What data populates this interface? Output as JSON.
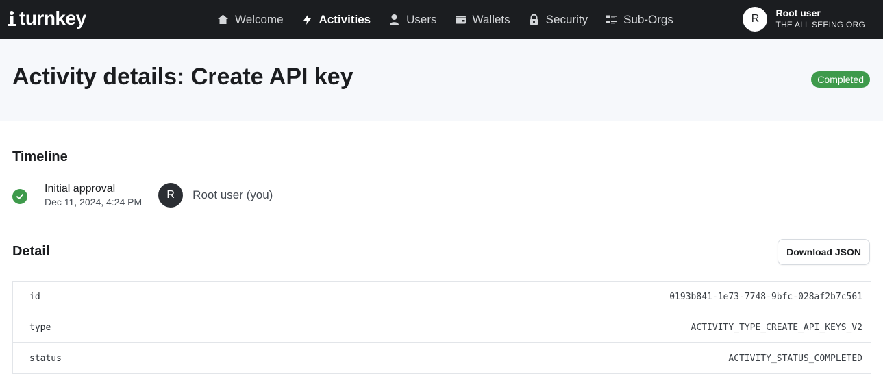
{
  "brand": {
    "name": "turnkey"
  },
  "nav": {
    "items": [
      {
        "label": "Welcome",
        "icon": "home-icon"
      },
      {
        "label": "Activities",
        "icon": "bolt-icon",
        "active": true
      },
      {
        "label": "Users",
        "icon": "user-icon"
      },
      {
        "label": "Wallets",
        "icon": "wallet-icon"
      },
      {
        "label": "Security",
        "icon": "lock-icon"
      },
      {
        "label": "Sub-Orgs",
        "icon": "list-icon"
      }
    ]
  },
  "user": {
    "initial": "R",
    "name": "Root user",
    "org": "THE ALL SEEING ORG"
  },
  "page": {
    "title": "Activity details: Create API key",
    "status": "Completed"
  },
  "timeline": {
    "title": "Timeline",
    "entry": {
      "label": "Initial approval",
      "date": "Dec 11, 2024, 4:24 PM",
      "user_initial": "R",
      "user_name": "Root user (you)"
    }
  },
  "detail": {
    "title": "Detail",
    "download_label": "Download JSON",
    "rows": [
      {
        "key": "id",
        "value": "0193b841-1e73-7748-9bfc-028af2b7c561"
      },
      {
        "key": "type",
        "value": "ACTIVITY_TYPE_CREATE_API_KEYS_V2"
      },
      {
        "key": "status",
        "value": "ACTIVITY_STATUS_COMPLETED"
      }
    ]
  },
  "colors": {
    "topbar": "#1b1d20",
    "success": "#3e9a4b",
    "hero_bg": "#f6f8fb"
  }
}
